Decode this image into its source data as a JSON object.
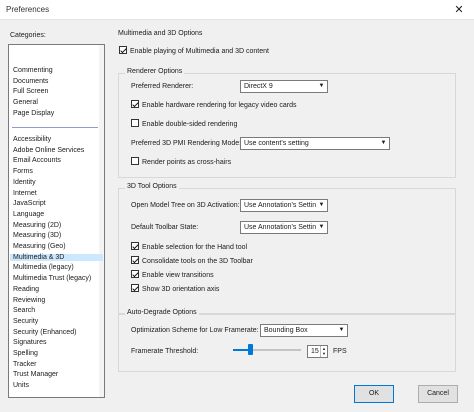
{
  "window": {
    "title": "Preferences",
    "close_glyph": "✕"
  },
  "categories": {
    "label": "Categories:",
    "group1": [
      "Commenting",
      "Documents",
      "Full Screen",
      "General",
      "Page Display"
    ],
    "group2": [
      "Accessibility",
      "Adobe Online Services",
      "Email Accounts",
      "Forms",
      "Identity",
      "Internet",
      "JavaScript",
      "Language",
      "Measuring (2D)",
      "Measuring (3D)",
      "Measuring (Geo)",
      "Multimedia & 3D",
      "Multimedia (legacy)",
      "Multimedia Trust (legacy)",
      "Reading",
      "Reviewing",
      "Search",
      "Security",
      "Security (Enhanced)",
      "Signatures",
      "Spelling",
      "Tracker",
      "Trust Manager",
      "Units"
    ],
    "selected": "Multimedia & 3D"
  },
  "main": {
    "title": "Multimedia and 3D Options",
    "enable_playing": "Enable playing of Multimedia and 3D content",
    "renderer": {
      "title": "Renderer Options",
      "preferred_label": "Preferred Renderer:",
      "preferred_value": "DirectX 9",
      "hw_label": "Enable hardware rendering for legacy video cards",
      "double_label": "Enable double-sided rendering",
      "pmi_label": "Preferred 3D PMI Rendering Mode:",
      "pmi_value": "Use content's setting",
      "crosshairs_label": "Render points as cross-hairs"
    },
    "tool": {
      "title": "3D Tool Options",
      "tree_label": "Open Model Tree on 3D Activation:",
      "tree_value": "Use Annotation's Setting",
      "toolbar_label": "Default Toolbar State:",
      "toolbar_value": "Use Annotation's Setting",
      "hand_label": "Enable selection for the Hand tool",
      "consolidate_label": "Consolidate tools on the 3D Toolbar",
      "transitions_label": "Enable view transitions",
      "orientation_label": "Show 3D orientation axis"
    },
    "degrade": {
      "title": "Auto-Degrade Options",
      "scheme_label": "Optimization Scheme for Low Framerate:",
      "scheme_value": "Bounding Box",
      "threshold_label": "Framerate Threshold:",
      "threshold_value": "15",
      "fps_label": "FPS",
      "slider_fraction": 0.25
    }
  },
  "buttons": {
    "ok": "OK",
    "cancel": "Cancel"
  },
  "colors": {
    "accent": "#0078d7",
    "selection": "#cce8ff"
  },
  "icons": {
    "dropdown": "chevron-down-icon",
    "spin": "spin-arrows-icon"
  }
}
